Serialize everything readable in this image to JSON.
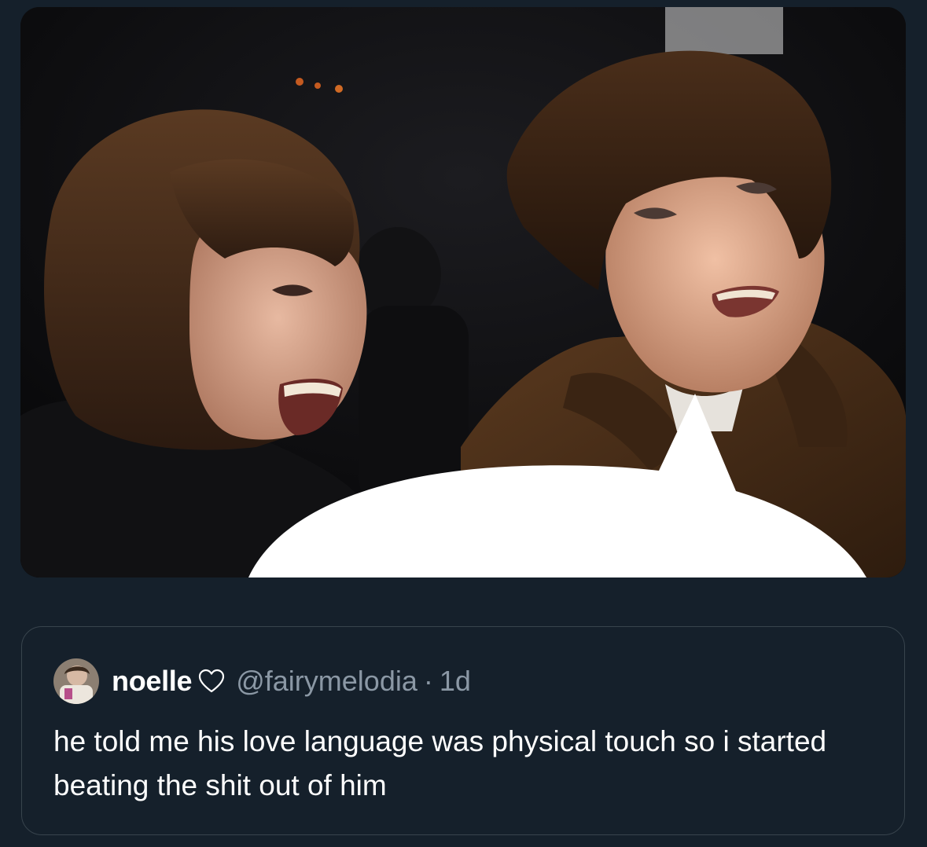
{
  "media": {
    "icon": "photo-two-men-with-speech-bubble"
  },
  "quoted_tweet": {
    "display_name": "noelle",
    "name_emoji_icon": "white-heart-icon",
    "handle": "@fairymelodia",
    "separator": "·",
    "time": "1d",
    "text": "he told me his love language was physical touch so i started beating the shit out of him"
  },
  "colors": {
    "background": "#15202b",
    "card_border": "#38444d",
    "secondary_text": "#8b98a5",
    "primary_text": "#ffffff"
  }
}
